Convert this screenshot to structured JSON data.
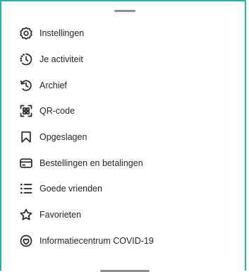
{
  "menu": {
    "items": [
      {
        "label": "Instellingen",
        "icon": "settings-icon"
      },
      {
        "label": "Je activiteit",
        "icon": "activity-icon"
      },
      {
        "label": "Archief",
        "icon": "archive-icon"
      },
      {
        "label": "QR-code",
        "icon": "qr-code-icon"
      },
      {
        "label": "Opgeslagen",
        "icon": "bookmark-icon"
      },
      {
        "label": "Bestellingen en betalingen",
        "icon": "credit-card-icon"
      },
      {
        "label": "Goede vrienden",
        "icon": "close-friends-list-icon"
      },
      {
        "label": "Favorieten",
        "icon": "star-icon"
      },
      {
        "label": "Informatiecentrum COVID-19",
        "icon": "covid-info-icon"
      }
    ]
  },
  "colors": {
    "frame_border": "#1fb5ad",
    "text": "#262626",
    "icon": "#262626",
    "handle": "#8e8e8e"
  }
}
